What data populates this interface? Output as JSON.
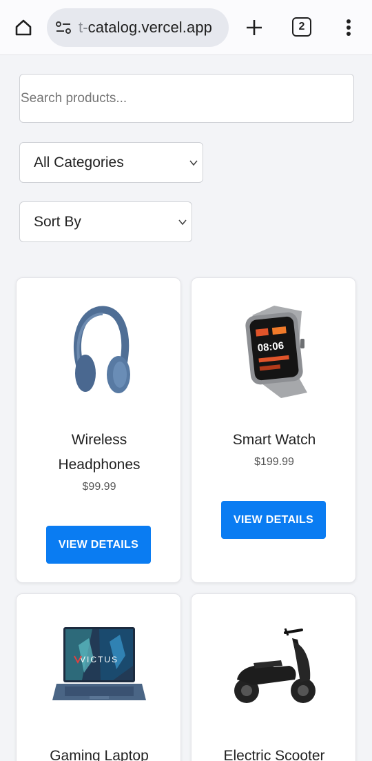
{
  "browser": {
    "url_prefix": "t-",
    "url_domain": "catalog.vercel.app",
    "tab_count": "2",
    "icons": {
      "home": "home-icon",
      "site_info": "site-settings-icon",
      "new_tab": "plus-icon",
      "menu": "more-vert-icon"
    }
  },
  "search": {
    "placeholder": "Search products...",
    "value": ""
  },
  "filters": {
    "category": {
      "selected": "All Categories"
    },
    "sort": {
      "selected": "Sort By"
    }
  },
  "products": [
    {
      "name": "Wireless Headphones",
      "name_line1": "Wireless",
      "name_line2": "Headphones",
      "price": "$99.99",
      "button": "VIEW DETAILS"
    },
    {
      "name": "Smart Watch",
      "price": "$199.99",
      "button": "VIEW DETAILS"
    },
    {
      "name": "Gaming Laptop",
      "laptop_brand": "VICTUS"
    },
    {
      "name": "Electric Scooter"
    }
  ],
  "colors": {
    "accent": "#0a7cf2",
    "page_bg": "#f3f4f7",
    "card_bg": "#ffffff"
  }
}
